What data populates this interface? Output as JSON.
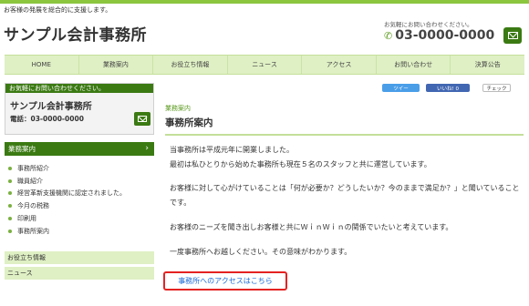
{
  "header": {
    "tagline": "お客様の発展を総合的に支援します。",
    "site_title": "サンプル会計事務所",
    "contact_label": "お気軽にお問い合わせください。",
    "phone": "03-0000-0000"
  },
  "nav": {
    "items": [
      "HOME",
      "業務案内",
      "お役立ち情報",
      "ニュース",
      "アクセス",
      "お問い合わせ",
      "決算公告"
    ]
  },
  "sidebar": {
    "contact_heading": "お気軽にお問い合わせください。",
    "office_name": "サンプル会計事務所",
    "phone": "電話：03-0000-0000",
    "menu_heading": "業務案内",
    "menu_items": [
      "事務所紹介",
      "職員紹介",
      "経営革新支援機関に認定されました。",
      "今月の税務",
      "印刷用",
      "事務所案内"
    ],
    "links": [
      "お役立ち情報",
      "ニュース"
    ]
  },
  "share": {
    "tweet": "ツイー",
    "like": "いいね! 0",
    "hatena": "チェック"
  },
  "main": {
    "breadcrumb": "業務案内",
    "title": "事務所案内",
    "paragraphs": [
      "当事務所は平成元年に開業しました。",
      "最初は私ひとりから始めた事務所も現在５名のスタッフと共に運営しています。",
      "お客様に対して心がけていることは「何が必要か？どうしたいか？今のままで満足か？」と聞いていることです。",
      "お客様のニーズを聞き出しお客様と共にＷｉｎＷｉｎの関係でいたいと考えています。",
      "一度事務所へお越しください。その意味がわかります。"
    ],
    "access_link": "事務所へのアクセスはこちら"
  },
  "colors": {
    "brand_green": "#3b7a13",
    "light_green": "#dff0c4",
    "link_blue": "#1c6bd6",
    "highlight_red": "#e52222"
  }
}
